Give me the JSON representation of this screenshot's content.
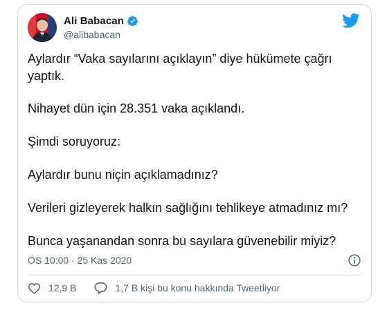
{
  "author": {
    "display_name": "Ali Babacan",
    "handle": "@alibabacan",
    "verified": true
  },
  "tweet": {
    "paragraphs": [
      "Aylardır “Vaka sayılarını açıklayın” diye hükümete çağrı yaptık.",
      "Nihayet dün için 28.351 vaka açıklandı.",
      "Şimdi soruyoruz:",
      "Aylardır bunu niçin açıklamadınız?",
      "Verileri gizleyerek halkın sağlığını tehlikeye atmadınız mı?",
      "Bunca yaşanandan sonra bu sayılara güvenebilir miyiz?"
    ],
    "timestamp": "ÖS 10:00 · 25 Kas 2020"
  },
  "actions": {
    "likes": "12,9 B",
    "replies": "1,7 B kişi bu konu hakkında Tweetliyor"
  },
  "icons": {
    "verified": "verified-badge-icon",
    "brand": "twitter-bird-icon",
    "info": "info-icon",
    "like": "heart-icon",
    "reply": "comment-icon"
  },
  "colors": {
    "brand_blue": "#1d9bf0",
    "text_primary": "#0f1419",
    "text_secondary": "#536471",
    "border": "#cfd9de"
  }
}
